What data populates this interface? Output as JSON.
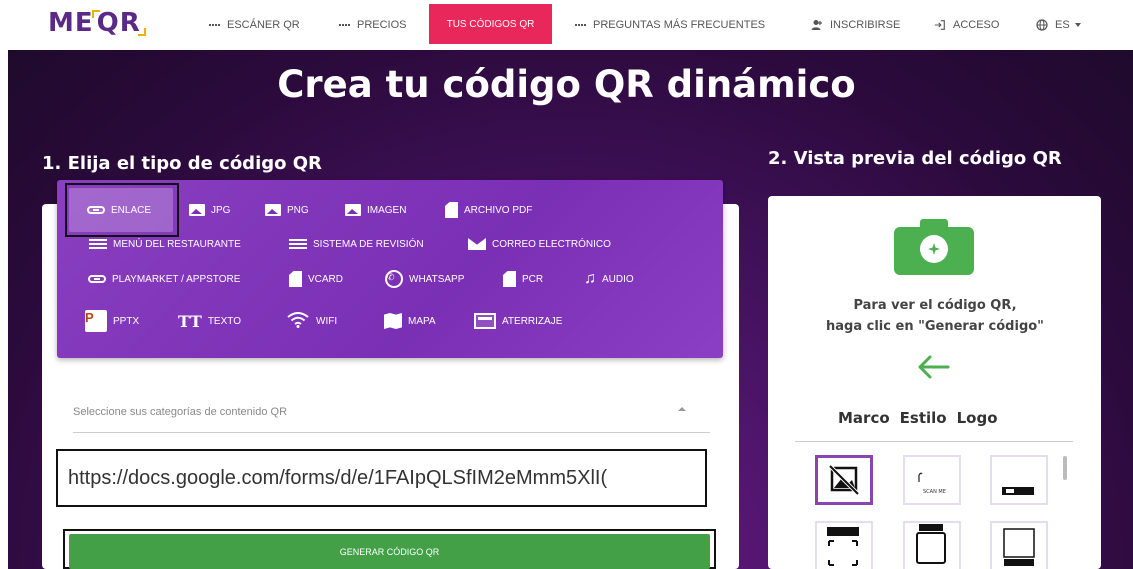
{
  "nav": {
    "logo": "MEQR",
    "items": [
      {
        "label": "ESCÁNER QR",
        "icon": "qr-grid-icon"
      },
      {
        "label": "PRECIOS",
        "icon": "price-grid-icon"
      },
      {
        "label": "TUS CÓDIGOS QR",
        "active": true
      },
      {
        "label": "PREGUNTAS MÁS FRECUENTES",
        "icon": "qr-grid-icon"
      },
      {
        "label": "INSCRIBIRSE",
        "icon": "user-add-icon"
      },
      {
        "label": "ACCESO",
        "icon": "login-icon"
      },
      {
        "label": "ES",
        "icon": "globe-icon"
      }
    ],
    "active_color": "#e8275a"
  },
  "hero": {
    "title": "Crea tu código QR dinámico",
    "step1": "1. Elija el tipo de código QR",
    "step2": "2. Vista previa del código QR"
  },
  "types": [
    {
      "label": "ENLACE",
      "icon": "link-icon",
      "selected": true
    },
    {
      "label": "JPG",
      "icon": "image-icon"
    },
    {
      "label": "PNG",
      "icon": "image-icon"
    },
    {
      "label": "IMAGEN",
      "icon": "image-icon"
    },
    {
      "label": "ARCHIVO PDF",
      "icon": "file-icon"
    },
    {
      "label": "MENÚ DEL RESTAURANTE",
      "icon": "menu-icon"
    },
    {
      "label": "SISTEMA DE REVISIÓN",
      "icon": "menu-icon"
    },
    {
      "label": "CORREO ELECTRÓNICO",
      "icon": "mail-icon"
    },
    {
      "label": "PLAYMARKET / APPSTORE",
      "icon": "link-icon"
    },
    {
      "label": "VCARD",
      "icon": "file-icon"
    },
    {
      "label": "WHATSAPP",
      "icon": "whatsapp-icon"
    },
    {
      "label": "PCR",
      "icon": "file-icon"
    },
    {
      "label": "AUDIO",
      "icon": "music-icon"
    },
    {
      "label": "PPTX",
      "icon": "powerpoint-icon"
    },
    {
      "label": "TEXTO",
      "icon": "text-icon"
    },
    {
      "label": "WIFI",
      "icon": "wifi-icon"
    },
    {
      "label": "MAPA",
      "icon": "map-icon"
    },
    {
      "label": "ATERRIZAJE",
      "icon": "landing-icon"
    }
  ],
  "form": {
    "category_placeholder": "Seleccione sus categorías de contenido QR",
    "url_value": "https://docs.google.com/forms/d/e/1FAIpQLSfIM2eMmm5XlI(",
    "generate_label": "GENERAR CÓDIGO QR",
    "generate_color": "#43a047"
  },
  "preview": {
    "hint_line1": "Para ver el código QR,",
    "hint_line2": "haga clic en \"Generar código\"",
    "tabs": [
      "Marco",
      "Estilo",
      "Logo"
    ],
    "frame_captions": [
      "SCAN ME",
      "SCAN ME"
    ]
  }
}
